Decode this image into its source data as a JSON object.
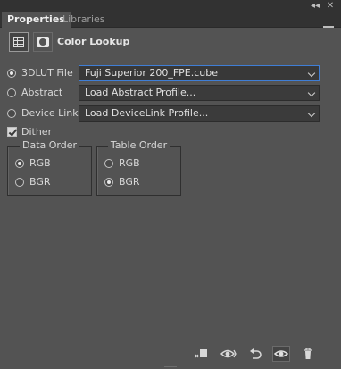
{
  "window": {
    "collapse_glyph": "◂◂",
    "close_glyph": "✕"
  },
  "tabs": [
    {
      "label": "Properties",
      "active": true
    },
    {
      "label": "Libraries",
      "active": false
    }
  ],
  "header": {
    "title": "Color Lookup",
    "icons": [
      "adjustment-grid-icon",
      "layer-mask-icon"
    ]
  },
  "lookup_rows": [
    {
      "label": "3DLUT File",
      "selected": true,
      "value": "Fuji Superior 200_FPE.cube"
    },
    {
      "label": "Abstract",
      "selected": false,
      "value": "Load Abstract Profile..."
    },
    {
      "label": "Device Link",
      "selected": false,
      "value": "Load DeviceLink Profile..."
    }
  ],
  "dither": {
    "label": "Dither",
    "checked": true
  },
  "data_order": {
    "legend": "Data Order",
    "options": [
      {
        "label": "RGB",
        "selected": true
      },
      {
        "label": "BGR",
        "selected": false
      }
    ]
  },
  "table_order": {
    "legend": "Table Order",
    "options": [
      {
        "label": "RGB",
        "selected": false
      },
      {
        "label": "BGR",
        "selected": true
      }
    ]
  },
  "bottom_bar": {
    "icons": [
      "clip-to-layer-icon",
      "view-previous-state-icon",
      "reset-icon",
      "visibility-eye-icon",
      "trash-icon"
    ]
  },
  "colors": {
    "panel_bg": "#535353",
    "focus_border": "#3f7ed6"
  }
}
